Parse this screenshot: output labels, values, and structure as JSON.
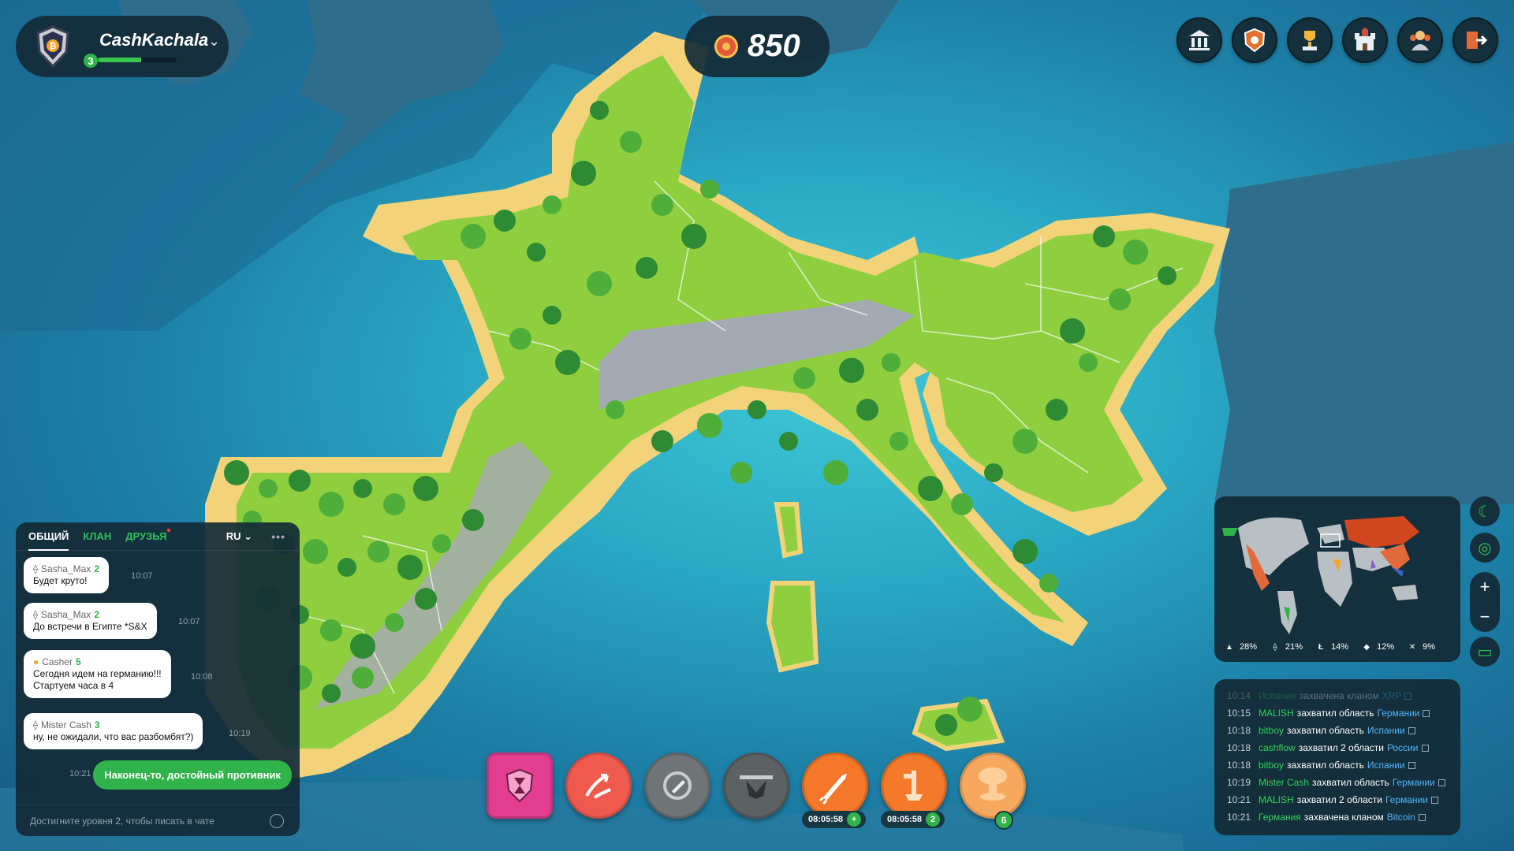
{
  "profile": {
    "name": "CashKachala",
    "level": "3",
    "xp_fraction": 0.55
  },
  "coins": {
    "amount": "850"
  },
  "top_icons": [
    "bank-icon",
    "clan-shield-icon",
    "trophy-icon",
    "castle-icon",
    "warriors-icon",
    "logout-icon"
  ],
  "chat": {
    "tabs": [
      "ОБЩИЙ",
      "КЛАН",
      "ДРУЗЬЯ"
    ],
    "lang": "RU",
    "more": "•••",
    "messages": [
      {
        "author": "Sasha_Max",
        "level": "2",
        "coin": "ethereum",
        "text": "Будет круто!",
        "time": "10:07"
      },
      {
        "author": "Sasha_Max",
        "level": "2",
        "coin": "ethereum",
        "text": "До встречи в Египте *S&X",
        "time": "10:07"
      },
      {
        "author": "Casher",
        "level": "5",
        "coin": "bitcoin",
        "text": "Сегодня идем на германию!!!\nСтартуем часа в 4",
        "time": "10:08"
      },
      {
        "author": "Mister Cash",
        "level": "3",
        "coin": "ethereum",
        "text": "ну, не ожидали, что вас разбомбят?)",
        "time": "10:19"
      }
    ],
    "my_message": {
      "text": "Наконец-то, достойный противник",
      "time": "10:21"
    },
    "input_placeholder": "Достигните уровня 2, чтобы писать в чате"
  },
  "actions": [
    {
      "icon": "hourglass-shield-icon",
      "color": "#e23d8e"
    },
    {
      "icon": "split-arrow-icon",
      "color": "#f06a5a"
    },
    {
      "icon": "pencil-icon",
      "color": "#6f7476"
    },
    {
      "icon": "drone-icon",
      "color": "#5c6163"
    },
    {
      "icon": "missile-icon",
      "color": "#f47a2c",
      "timer": "08:05:58",
      "badge": "+"
    },
    {
      "icon": "rocket-launch-icon",
      "color": "#f5792b",
      "timer": "08:05:58",
      "badge": "2"
    },
    {
      "icon": "nuke-icon",
      "color": "#f6a05a",
      "count": "6"
    }
  ],
  "minimap": {
    "stats": [
      {
        "coin": "tron",
        "value": "28%",
        "color": "#8a5cc4"
      },
      {
        "coin": "ethereum",
        "value": "21%",
        "color": "#6b7c8a"
      },
      {
        "coin": "litecoin",
        "value": "14%",
        "color": "#3d63c9"
      },
      {
        "coin": "binance",
        "value": "12%",
        "color": "#f0b90b"
      },
      {
        "coin": "xrp",
        "value": "9%",
        "color": "#8f9aa3"
      }
    ]
  },
  "events": [
    {
      "time": "10:14",
      "actor": "Испания",
      "action": "захвачена кланом",
      "target": "XRP",
      "faded": true
    },
    {
      "time": "10:15",
      "actor": "MALISH",
      "action": "захватил область",
      "target": "Германии"
    },
    {
      "time": "10:18",
      "actor": "bitboy",
      "action": "захватил область",
      "target": "Испании"
    },
    {
      "time": "10:18",
      "actor": "cashflow",
      "action": "захватил 2 области",
      "target": "России"
    },
    {
      "time": "10:18",
      "actor": "bitboy",
      "action": "захватил область",
      "target": "Испании"
    },
    {
      "time": "10:19",
      "actor": "Mister Cash",
      "action": "захватил область",
      "target": "Германии"
    },
    {
      "time": "10:21",
      "actor": "MALISH",
      "action": "захватил 2 области",
      "target": "Германии"
    },
    {
      "time": "10:21",
      "actor": "Германия",
      "action": "захвачена кланом",
      "target": "Bitcoin"
    }
  ],
  "colors": {
    "accent_green": "#2fb34a",
    "panel": "#142a36",
    "link_blue": "#4fb6ff"
  }
}
